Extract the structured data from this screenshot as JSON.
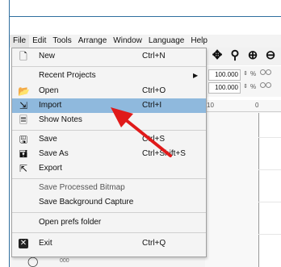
{
  "menubar": {
    "items": [
      "File",
      "Edit",
      "Tools",
      "Arrange",
      "Window",
      "Language",
      "Help"
    ],
    "active": "File"
  },
  "file_menu": {
    "items": [
      {
        "label": "New",
        "shortcut": "Ctrl+N",
        "icon": "new-file-icon"
      },
      {
        "label": "Recent Projects",
        "shortcut": "",
        "icon": "",
        "submenu": true
      },
      {
        "label": "Open",
        "shortcut": "Ctrl+O",
        "icon": "folder-icon"
      },
      {
        "label": "Import",
        "shortcut": "Ctrl+I",
        "icon": "import-icon",
        "selected": true
      },
      {
        "label": "Show Notes",
        "shortcut": "",
        "icon": "notes-icon"
      },
      {
        "label": "Save",
        "shortcut": "Ctrl+S",
        "icon": "save-icon"
      },
      {
        "label": "Save As",
        "shortcut": "Ctrl+Shift+S",
        "icon": "save-as-icon"
      },
      {
        "label": "Export",
        "shortcut": "",
        "icon": "export-icon"
      },
      {
        "label": "Save Processed Bitmap",
        "shortcut": "",
        "icon": "",
        "muted": true
      },
      {
        "label": "Save Background Capture",
        "shortcut": "",
        "icon": ""
      },
      {
        "label": "Open prefs folder",
        "shortcut": "",
        "icon": ""
      },
      {
        "label": "Exit",
        "shortcut": "Ctrl+Q",
        "icon": "exit-icon"
      }
    ]
  },
  "toolbar": {
    "icons": [
      "move-icon",
      "zoom-fit-icon",
      "zoom-in-icon",
      "zoom-out-icon"
    ]
  },
  "coords": {
    "row1_value": "100.000",
    "row2_value": "100.000",
    "percent": "%"
  },
  "ruler": {
    "labels": [
      "10",
      "0"
    ]
  },
  "status": {
    "text": "000"
  },
  "colors": {
    "selected_highlight": "#8fb9dd",
    "arrow": "#e01a1a",
    "frame": "#2f6f9f"
  }
}
